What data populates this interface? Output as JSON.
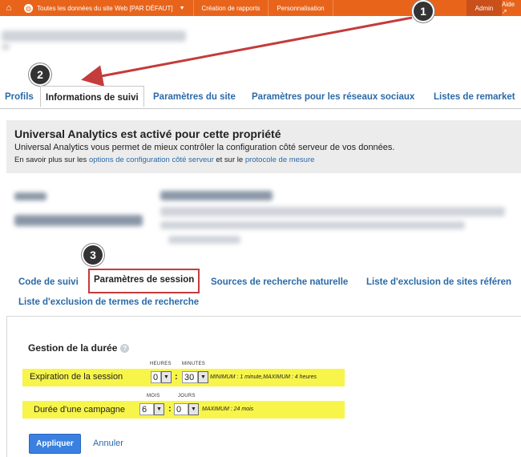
{
  "topbar": {
    "home_icon": "home-icon",
    "site_selector": "Toutes les données du site Web [PAR DÉFAUT]",
    "reports": "Création de rapports",
    "custom": "Personnalisation",
    "admin": "Admin",
    "help": "Aide ↗"
  },
  "badges": [
    "1",
    "2",
    "3"
  ],
  "tabs": [
    {
      "label": "Profils"
    },
    {
      "label": "Informations de suivi",
      "active": true
    },
    {
      "label": "Paramètres du site"
    },
    {
      "label": "Paramètres pour les réseaux sociaux"
    },
    {
      "label": "Listes de remarket"
    }
  ],
  "ua_notice": {
    "title": "Universal Analytics est activé pour cette propriété",
    "line1": "Universal Analytics vous permet de mieux contrôler la configuration côté serveur de vos données.",
    "line2_prefix": "En savoir plus sur les ",
    "line2_link1": "options de configuration côté serveur",
    "line2_mid": " et sur le ",
    "line2_link2": "protocole de mesure"
  },
  "subtabs": {
    "code": "Code de suivi",
    "session": "Paramètres de session",
    "organic": "Sources de recherche naturelle",
    "referral": "Liste d'exclusion de sites référen",
    "terms": "Liste d'exclusion de termes de recherche"
  },
  "duration": {
    "title": "Gestion de la durée",
    "help": "?",
    "session_label": "Expiration de la session",
    "hours_label": "HEURES",
    "minutes_label": "MINUTES",
    "hours_value": "0",
    "minutes_value": "30",
    "session_note": "MINIMUM : 1 minute,MAXIMUM : 4 heures",
    "campaign_label": "Durée d'une campagne",
    "months_label": "MOIS",
    "days_label": "JOURS",
    "months_value": "6",
    "days_value": "0",
    "campaign_note": "MAXIMUM : 24 mois"
  },
  "actions": {
    "apply": "Appliquer",
    "cancel": "Annuler"
  },
  "colors": {
    "accent_orange": "#e8641b",
    "link_blue": "#2a6aa8",
    "highlight_yellow": "#f7f54a",
    "annotation_red": "#c43c3c"
  }
}
